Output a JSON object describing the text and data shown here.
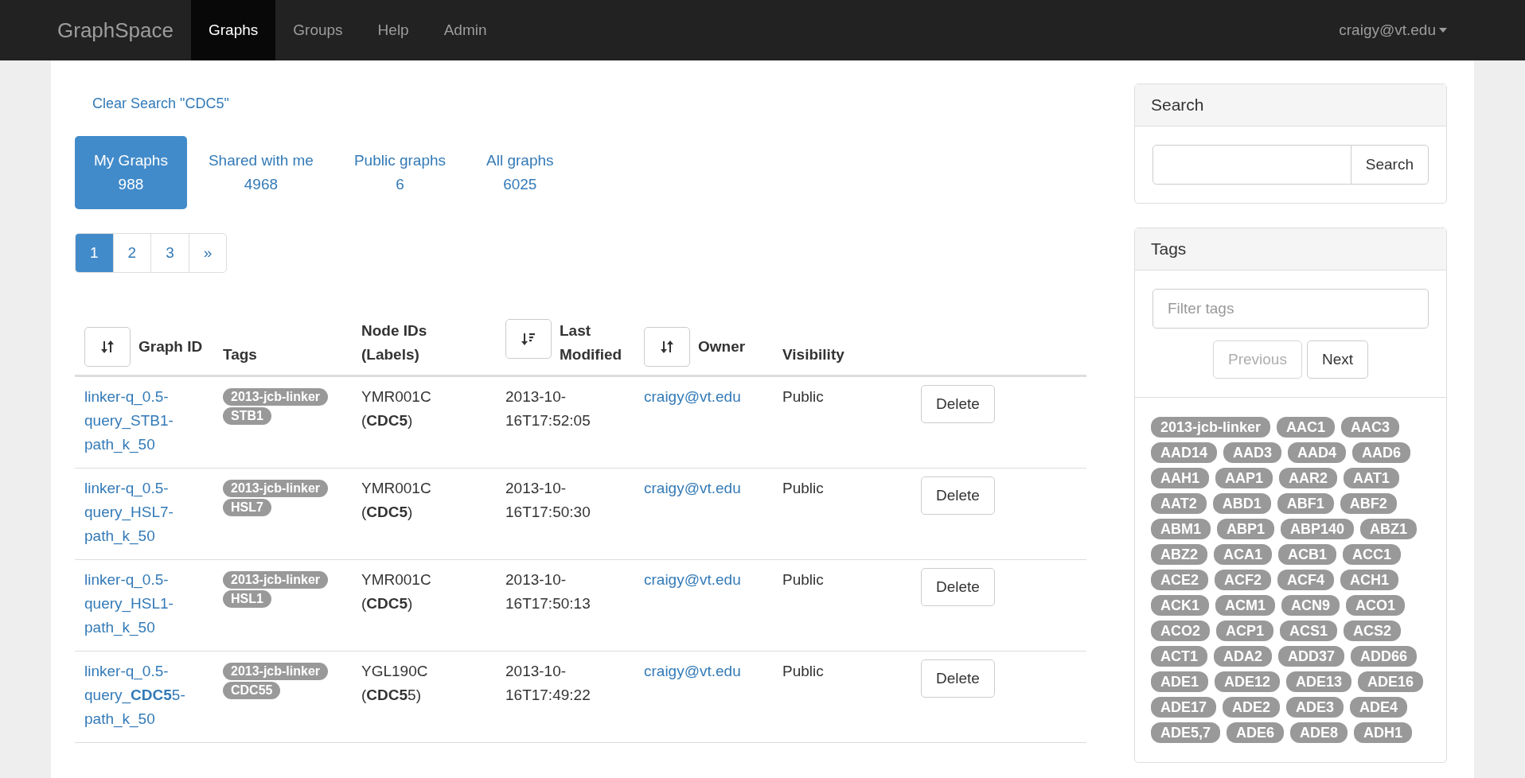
{
  "navbar": {
    "brand": "GraphSpace",
    "items": [
      {
        "label": "Graphs",
        "selected": true
      },
      {
        "label": "Groups",
        "selected": false
      },
      {
        "label": "Help",
        "selected": false
      },
      {
        "label": "Admin",
        "selected": false
      }
    ],
    "user": "craigy@vt.edu"
  },
  "clear_search": "Clear Search \"CDC5\"",
  "tabs": [
    {
      "label": "My Graphs",
      "count": "988",
      "selected": true
    },
    {
      "label": "Shared with me",
      "count": "4968",
      "selected": false
    },
    {
      "label": "Public graphs",
      "count": "6",
      "selected": false
    },
    {
      "label": "All graphs",
      "count": "6025",
      "selected": false
    }
  ],
  "pagination": [
    {
      "label": "1",
      "selected": true
    },
    {
      "label": "2",
      "selected": false
    },
    {
      "label": "3",
      "selected": false
    },
    {
      "label": "»",
      "selected": false
    }
  ],
  "table": {
    "columns": [
      {
        "label": "Graph ID",
        "sortable": true
      },
      {
        "label": "Tags",
        "sortable": false
      },
      {
        "label": "Node IDs (Labels)",
        "sortable": false
      },
      {
        "label": "Last Modified",
        "sortable": true
      },
      {
        "label": "Owner",
        "sortable": true
      },
      {
        "label": "Visibility",
        "sortable": false
      }
    ],
    "rows": [
      {
        "graph_id": "linker-q_0.5-query_STB1-path_k_50",
        "tags": [
          "2013-jcb-linker",
          "STB1"
        ],
        "node_id": "YMR001C",
        "label": "(**CDC5**)",
        "modified": "2013-10-16T17:52:05",
        "owner": "craigy@vt.edu",
        "visibility": "Public",
        "action": "Delete"
      },
      {
        "graph_id": "linker-q_0.5-query_HSL7-path_k_50",
        "tags": [
          "2013-jcb-linker",
          "HSL7"
        ],
        "node_id": "YMR001C",
        "label": "(**CDC5**)",
        "modified": "2013-10-16T17:50:30",
        "owner": "craigy@vt.edu",
        "visibility": "Public",
        "action": "Delete"
      },
      {
        "graph_id": "linker-q_0.5-query_HSL1-path_k_50",
        "tags": [
          "2013-jcb-linker",
          "HSL1"
        ],
        "node_id": "YMR001C",
        "label": "(**CDC5**)",
        "modified": "2013-10-16T17:50:13",
        "owner": "craigy@vt.edu",
        "visibility": "Public",
        "action": "Delete"
      },
      {
        "graph_id": "linker-q_0.5-query_**CDC5**5-path_k_50",
        "tags": [
          "2013-jcb-linker",
          "CDC55"
        ],
        "node_id": "YGL190C",
        "label": "(**CDC5**5)",
        "modified": "2013-10-16T17:49:22",
        "owner": "craigy@vt.edu",
        "visibility": "Public",
        "action": "Delete"
      }
    ]
  },
  "sidebar": {
    "search": {
      "title": "Search",
      "button": "Search"
    },
    "tags": {
      "title": "Tags",
      "placeholder": "Filter tags",
      "previous": "Previous",
      "next": "Next",
      "cloud": [
        "2013-jcb-linker",
        "AAC1",
        "AAC3",
        "AAD14",
        "AAD3",
        "AAD4",
        "AAD6",
        "AAH1",
        "AAP1",
        "AAR2",
        "AAT1",
        "AAT2",
        "ABD1",
        "ABF1",
        "ABF2",
        "ABM1",
        "ABP1",
        "ABP140",
        "ABZ1",
        "ABZ2",
        "ACA1",
        "ACB1",
        "ACC1",
        "ACE2",
        "ACF2",
        "ACF4",
        "ACH1",
        "ACK1",
        "ACM1",
        "ACN9",
        "ACO1",
        "ACO2",
        "ACP1",
        "ACS1",
        "ACS2",
        "ACT1",
        "ADA2",
        "ADD37",
        "ADD66",
        "ADE1",
        "ADE12",
        "ADE13",
        "ADE16",
        "ADE17",
        "ADE2",
        "ADE3",
        "ADE4",
        "ADE5,7",
        "ADE6",
        "ADE8",
        "ADH1"
      ]
    }
  }
}
